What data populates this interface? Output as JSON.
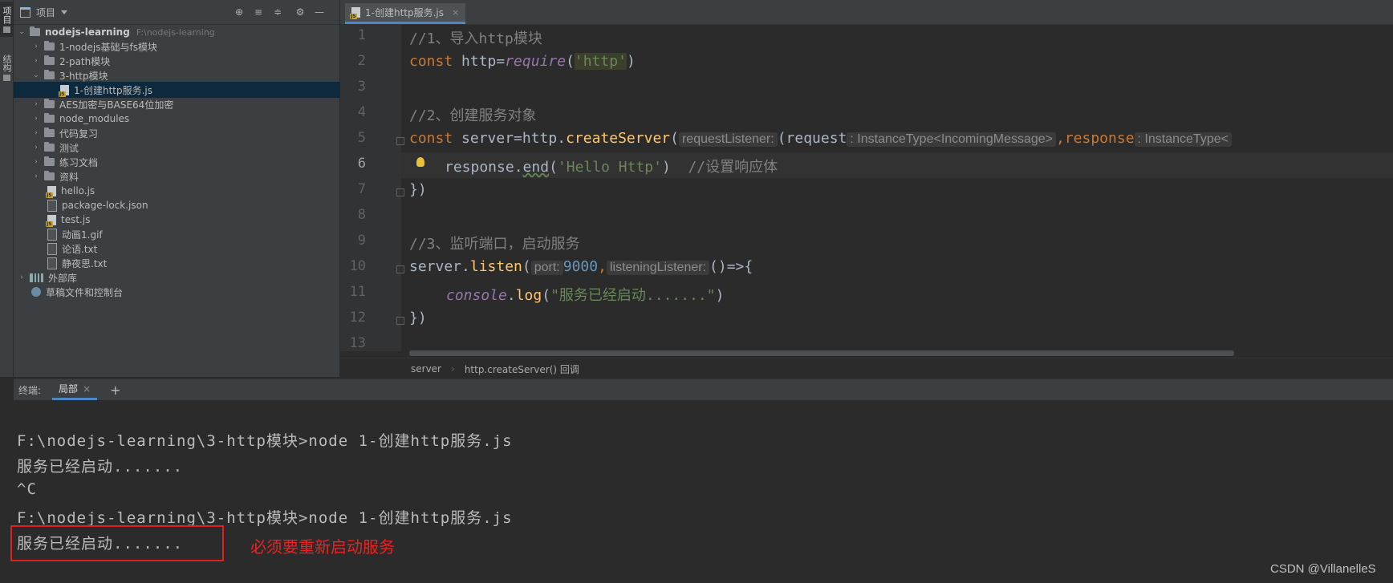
{
  "side_strip": {
    "tab1": "项目",
    "tab2": "结构"
  },
  "project_panel": {
    "title": "项目",
    "root": {
      "name": "nodejs-learning",
      "path": "F:\\nodejs-learning"
    },
    "items": [
      {
        "label": "1-nodejs基础与fs模块"
      },
      {
        "label": "2-path模块"
      },
      {
        "label": "3-http模块"
      },
      {
        "label": "1-创建http服务.js"
      },
      {
        "label": "AES加密与BASE64位加密"
      },
      {
        "label": "node_modules"
      },
      {
        "label": "代码复习"
      },
      {
        "label": "测试"
      },
      {
        "label": "练习文档"
      },
      {
        "label": "资料"
      },
      {
        "label": "hello.js"
      },
      {
        "label": "package-lock.json"
      },
      {
        "label": "test.js"
      },
      {
        "label": "动画1.gif"
      },
      {
        "label": "论语.txt"
      },
      {
        "label": "静夜思.txt"
      },
      {
        "label": "外部库"
      },
      {
        "label": "草稿文件和控制台"
      }
    ]
  },
  "editor": {
    "tab": {
      "label": "1-创建http服务.js",
      "close": "×"
    },
    "line_numbers": [
      "1",
      "2",
      "3",
      "4",
      "5",
      "6",
      "7",
      "8",
      "9",
      "10",
      "11",
      "12",
      "13"
    ],
    "code": {
      "l1": "//1、导入http模块",
      "l2_kw": "const",
      "l2_var": " http=",
      "l2_fn": "require",
      "l2_p1": "(",
      "l2_str": "'http'",
      "l2_p2": ")",
      "l4": "//2、创建服务对象",
      "l5_kw": "const",
      "l5_a": " server=http.",
      "l5_fn": "createServer",
      "l5_p": "(",
      "l5_hint1": "requestListener:",
      "l5_b": "(request",
      "l5_hint2": ": InstanceType<IncomingMessage>",
      "l5_c": ",response",
      "l5_hint3": ": InstanceType<",
      "l6_a": "response.",
      "l6_fn": "end",
      "l6_p": "(",
      "l6_str": "'Hello Http'",
      "l6_b": ")  ",
      "l6_com": "//设置响应体",
      "l7": "})",
      "l9": "//3、监听端口，启动服务",
      "l10_a": "server.",
      "l10_fn": "listen",
      "l10_p": "(",
      "l10_hint1": "port:",
      "l10_num": "9000",
      "l10_comma": ",",
      "l10_hint2": "listeningListener:",
      "l10_b": "()=>{",
      "l11_con": "console",
      "l11_a": ".",
      "l11_fn": "log",
      "l11_p": "(",
      "l11_str": "\"服务已经启动.......\"",
      "l11_b": ")",
      "l12": "})"
    },
    "breadcrumbs": {
      "item1": "server",
      "sep": "›",
      "item2": "http.createServer() 回调"
    }
  },
  "terminal": {
    "label": "终端:",
    "tab": "局部",
    "close": "×",
    "add": "+",
    "lines": [
      "F:\\nodejs-learning\\3-http模块>node 1-创建http服务.js",
      "服务已经启动.......",
      "^C",
      "F:\\nodejs-learning\\3-http模块>node 1-创建http服务.js",
      "服务已经启动......."
    ]
  },
  "annotation": "必须要重新启动服务",
  "watermark": "CSDN @VillanelleS",
  "colors": {
    "keyword": "#cc7832",
    "function": "#ffc66d",
    "string": "#6a8759",
    "number": "#6897bb",
    "comment": "#808080",
    "annotation": "#f02020"
  }
}
